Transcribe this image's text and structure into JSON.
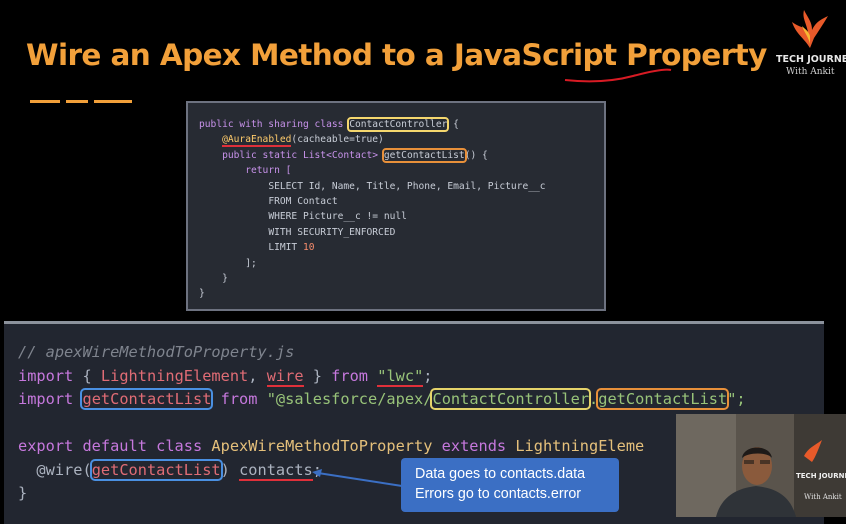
{
  "slide": {
    "title": "Wire an Apex Method to a JavaScript Property",
    "logo": {
      "name": "TECH JOURNEY",
      "sub": "With Ankit"
    }
  },
  "apex_code": {
    "line1": {
      "pre": "public with sharing class ",
      "class_name": "ContactController",
      "post": " {"
    },
    "line2": {
      "annotation": "@AuraEnabled",
      "args": "(cacheable=true)"
    },
    "line3": {
      "pre": "public static List<Contact> ",
      "method": "getContactList",
      "post": "() {"
    },
    "line4": "return [",
    "line5": "SELECT Id, Name, Title, Phone, Email, Picture__c",
    "line6": "FROM Contact",
    "line7": "WHERE Picture__c != null",
    "line8": "WITH SECURITY_ENFORCED",
    "line9_kw": "LIMIT",
    "line9_num": "10",
    "line10": "];",
    "line11": "}",
    "line12": "}"
  },
  "js_code": {
    "comment": "// apexWireMethodToProperty.js",
    "import_kw": "import",
    "from_kw": "from",
    "lightning_element": "LightningElement",
    "wire": "wire",
    "lwc_str": "\"lwc\"",
    "get_contact_list": "getContactList",
    "apex_path": "\"@salesforce/apex/",
    "contact_controller": "ContactController",
    "dot": ".",
    "quote_end": "\";",
    "export_line": {
      "kw": "export default class ",
      "cls": "ApexWireMethodToProperty",
      "ext": " extends ",
      "base": "LightningEleme"
    },
    "decorator": "@wire",
    "contacts": "contacts",
    "close_brace": "}"
  },
  "tooltip": {
    "line1": "Data goes to contacts.data",
    "line2": "Errors go to contacts.error"
  },
  "webcam": {
    "logo_name": "TECH JOURNEY",
    "logo_sub": "With Ankit"
  },
  "colors": {
    "title_orange": "#f2a03a",
    "tooltip_blue": "#3b6fc4"
  }
}
